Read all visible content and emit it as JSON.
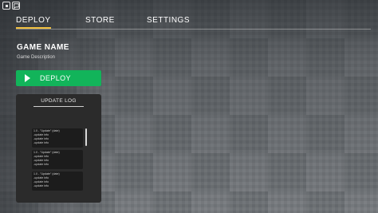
{
  "nav": {
    "tabs": [
      {
        "label": "DEPLOY",
        "active": true
      },
      {
        "label": "STORE",
        "active": false
      },
      {
        "label": "SETTINGS",
        "active": false
      }
    ]
  },
  "game": {
    "name": "GAME NAME",
    "description": "Game Description"
  },
  "deploy_button": {
    "label": "DEPLOY"
  },
  "update_log": {
    "title": "UPDATE LOG",
    "entries": [
      {
        "heading": "1.0 - \"Update\" (date)",
        "lines": [
          "-update info",
          "-update info",
          "-update info"
        ]
      },
      {
        "heading": "1.0 - \"Update\" (date)",
        "lines": [
          "-update info",
          "-update info",
          "-update info"
        ]
      },
      {
        "heading": "1.0 - \"Update\" (date)",
        "lines": [
          "-update info",
          "-update info",
          "-update info"
        ]
      }
    ]
  },
  "colors": {
    "accent_tab_underline": "#f0c040",
    "deploy_green": "#12b45a",
    "panel_dark": "#2b2b2b"
  },
  "icons": [
    "roblox-menu-icon",
    "chat-icon",
    "play-icon"
  ]
}
